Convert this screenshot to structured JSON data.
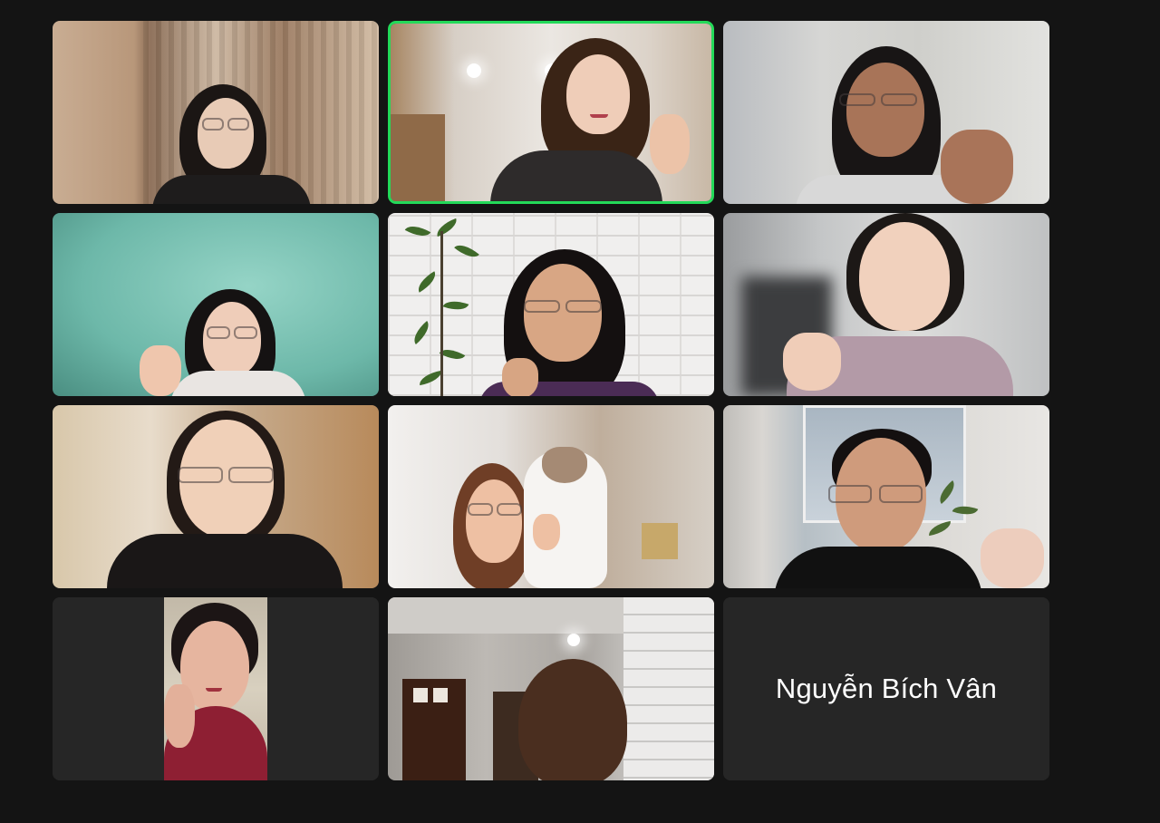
{
  "meeting": {
    "participants": [
      {
        "id": "p1",
        "video": true
      },
      {
        "id": "p2",
        "video": true,
        "active_speaker": true
      },
      {
        "id": "p3",
        "video": true
      },
      {
        "id": "p4",
        "video": true
      },
      {
        "id": "p5",
        "video": true
      },
      {
        "id": "p6",
        "video": true
      },
      {
        "id": "p7",
        "video": true
      },
      {
        "id": "p8",
        "video": true
      },
      {
        "id": "p9",
        "video": true
      },
      {
        "id": "p10",
        "video": true
      },
      {
        "id": "p11",
        "video": true
      },
      {
        "id": "p12",
        "video": false,
        "name": "Nguyễn Bích Vân"
      }
    ]
  },
  "colors": {
    "background": "#141414",
    "tile_off": "#262626",
    "active_speaker_border": "#23d959",
    "name_text": "#ffffff"
  }
}
